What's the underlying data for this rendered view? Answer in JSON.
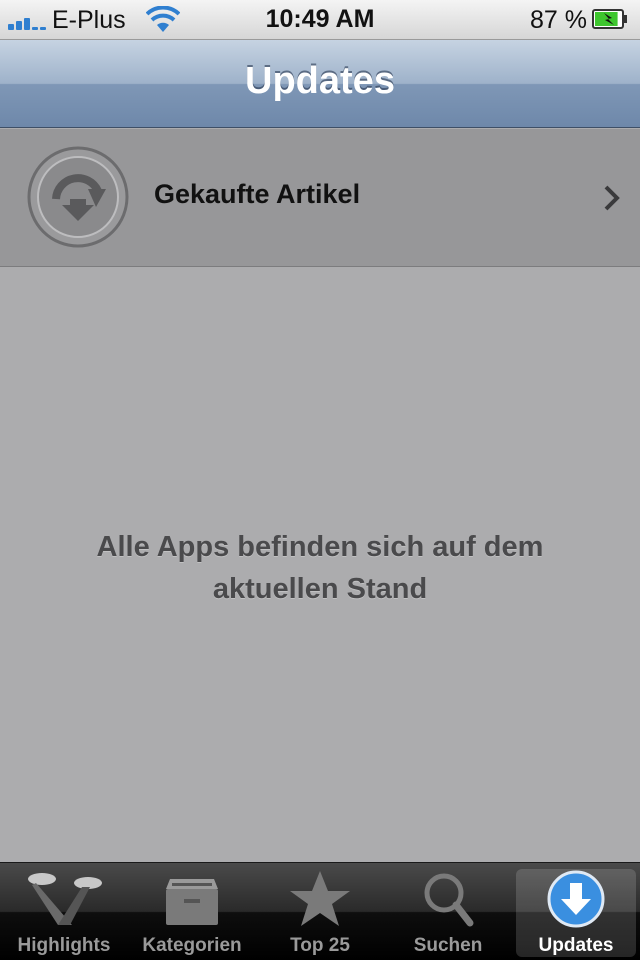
{
  "status_bar": {
    "carrier": "E-Plus",
    "time": "10:49 AM",
    "battery_percent": "87 %",
    "battery_level": 0.87,
    "icons": [
      "signal-bars-icon",
      "wifi-icon",
      "battery-charging-icon"
    ]
  },
  "nav": {
    "title": "Updates"
  },
  "purchased": {
    "label": "Gekaufte Artikel",
    "icon": "purchased-download-icon"
  },
  "empty": {
    "line1": "Alle Apps befinden sich auf dem",
    "line2": "aktuellen Stand"
  },
  "tabs": [
    {
      "label": "Highlights",
      "icon": "spotlight-icon",
      "active": false
    },
    {
      "label": "Kategorien",
      "icon": "box-icon",
      "active": false
    },
    {
      "label": "Top 25",
      "icon": "star-icon",
      "active": false
    },
    {
      "label": "Suchen",
      "icon": "search-icon",
      "active": false
    },
    {
      "label": "Updates",
      "icon": "download-icon",
      "active": true
    }
  ],
  "colors": {
    "accent_blue": "#3a8fe0",
    "battery_green": "#3ec62e",
    "nav_blue": "#7f97b6"
  }
}
